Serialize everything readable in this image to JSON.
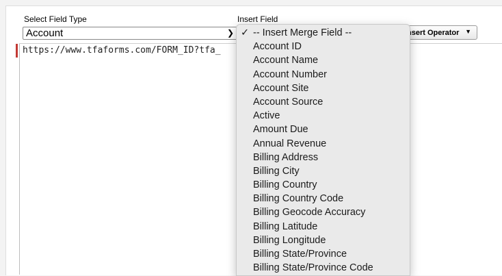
{
  "field_type": {
    "label": "Select Field Type",
    "selected": "Account",
    "chevron": "chevron-down-icon"
  },
  "insert_field": {
    "label": "Insert Field",
    "options": [
      "-- Insert Merge Field --",
      "Account ID",
      "Account Name",
      "Account Number",
      "Account Site",
      "Account Source",
      "Active",
      "Amount Due",
      "Annual Revenue",
      "Billing Address",
      "Billing City",
      "Billing Country",
      "Billing Country Code",
      "Billing Geocode Accuracy",
      "Billing Latitude",
      "Billing Longitude",
      "Billing State/Province",
      "Billing State/Province Code"
    ],
    "selected_index": 0,
    "check_mark": "✓"
  },
  "operator_button": {
    "label": "nsert Operator",
    "arrow": "▼"
  },
  "editor": {
    "value": "https://www.tfaforms.com/FORM_ID?tfa_"
  },
  "colors": {
    "required_bar": "#c23934",
    "dropdown_bg": "#eaeaea"
  }
}
